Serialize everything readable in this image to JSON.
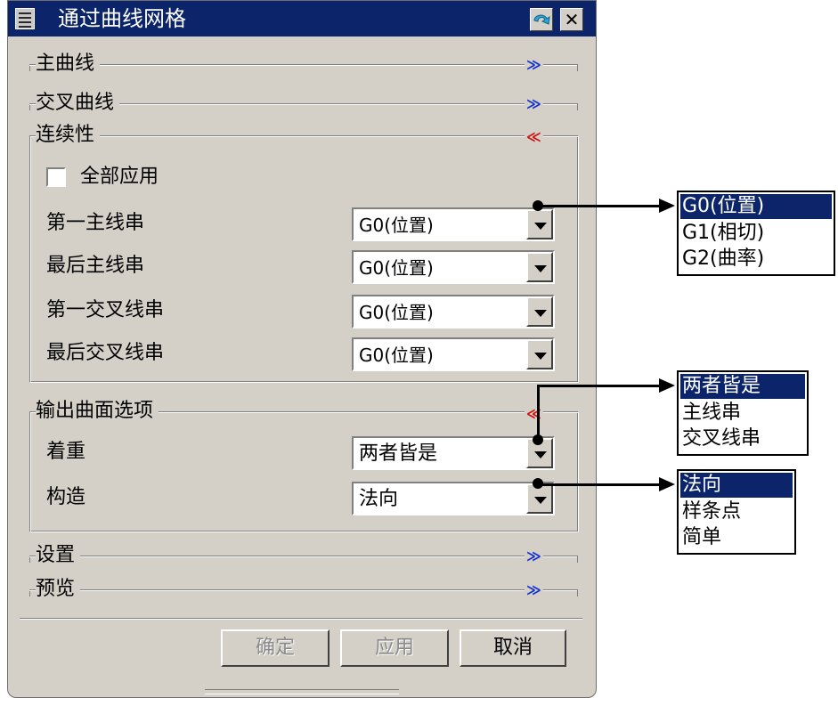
{
  "window": {
    "title": "通过曲线网格",
    "back_icon": "refresh-arrow-icon",
    "close_label": "✕"
  },
  "sections": {
    "primary": {
      "label": "主曲线",
      "state": "collapsed"
    },
    "cross": {
      "label": "交叉曲线",
      "state": "collapsed"
    },
    "continuity": {
      "label": "连续性",
      "state": "expanded",
      "apply_all": "全部应用",
      "rows": [
        {
          "label": "第一主线串",
          "value": "G0(位置)"
        },
        {
          "label": "最后主线串",
          "value": "G0(位置)"
        },
        {
          "label": "第一交叉线串",
          "value": "G0(位置)"
        },
        {
          "label": "最后交叉线串",
          "value": "G0(位置)"
        }
      ]
    },
    "output": {
      "label": "输出曲面选项",
      "state": "expanded",
      "rows": [
        {
          "label": "着重",
          "value": "两者皆是"
        },
        {
          "label": "构造",
          "value": "法向"
        }
      ]
    },
    "settings": {
      "label": "设置",
      "state": "collapsed"
    },
    "preview": {
      "label": "预览",
      "state": "collapsed"
    }
  },
  "buttons": {
    "ok": "确定",
    "apply": "应用",
    "cancel": "取消"
  },
  "popups": {
    "continuity_options": [
      "G0(位置)",
      "G1(相切)",
      "G2(曲率)"
    ],
    "emphasis_options": [
      "两者皆是",
      "主线串",
      "交叉线串"
    ],
    "construction_options": [
      "法向",
      "样条点",
      "简单"
    ]
  },
  "colors": {
    "title_bar": "#0b246a",
    "dialog_bg": "#d4d0c8",
    "selection": "#0b246a",
    "expand_chevron": "#1030d0",
    "collapse_chevron": "#d01010"
  }
}
